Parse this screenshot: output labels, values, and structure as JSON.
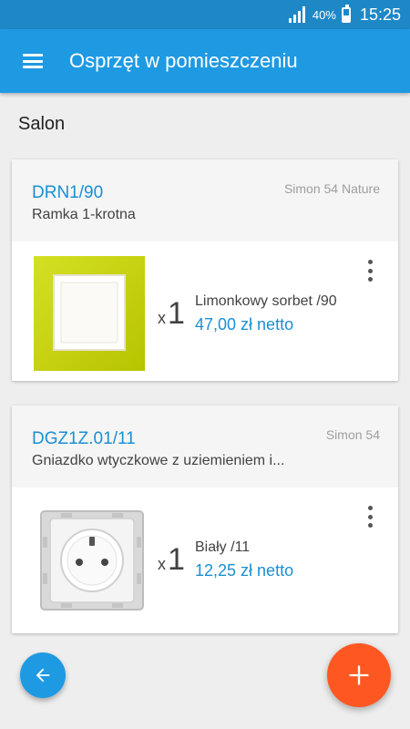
{
  "status_bar": {
    "battery": "40%",
    "time": "15:25",
    "icons": [
      "signal-icon",
      "battery-icon"
    ]
  },
  "app_bar": {
    "title": "Osprzęt w pomieszczeniu",
    "menu_icon": "menu-icon"
  },
  "section": {
    "title": "Salon"
  },
  "items": [
    {
      "code": "DRN1/90",
      "series": "Simon 54 Nature",
      "description": "Ramka 1-krotna",
      "quantity_prefix": "x",
      "quantity": "1",
      "variant": "Limonkowy sorbet /90",
      "price": "47,00 zł netto",
      "image": "lime-frame",
      "color": "#c8d400"
    },
    {
      "code": "DGZ1Z.01/11",
      "series": "Simon 54",
      "description": "Gniazdko wtyczkowe z uziemieniem i...",
      "quantity_prefix": "x",
      "quantity": "1",
      "variant": "Biały /11",
      "price": "12,25 zł netto",
      "image": "white-socket",
      "color": "#ffffff"
    }
  ],
  "actions": {
    "back_icon": "arrow-left-icon",
    "add_icon": "plus-icon"
  },
  "colors": {
    "status_bar": "#1e88c7",
    "app_bar": "#1e9ae3",
    "accent_blue": "#1a8fd4",
    "fab_orange": "#ff5722"
  }
}
